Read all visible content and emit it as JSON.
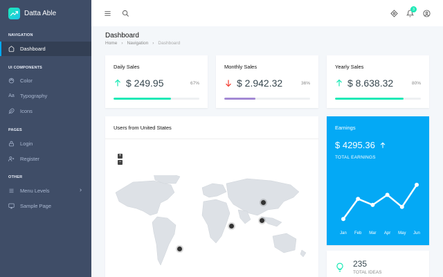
{
  "app": {
    "name": "Datta Able"
  },
  "sidebar": {
    "sections": [
      {
        "caption": "NAVIGATION",
        "items": [
          {
            "label": "Dashboard",
            "icon": "home-icon",
            "active": true
          }
        ]
      },
      {
        "caption": "UI COMPONENTS",
        "items": [
          {
            "label": "Color",
            "icon": "palette-icon"
          },
          {
            "label": "Typography",
            "icon": "typography-icon"
          },
          {
            "label": "Icons",
            "icon": "feather-icon"
          }
        ]
      },
      {
        "caption": "PAGES",
        "items": [
          {
            "label": "Login",
            "icon": "lock-icon"
          },
          {
            "label": "Register",
            "icon": "user-plus-icon"
          }
        ]
      },
      {
        "caption": "OTHER",
        "items": [
          {
            "label": "Menu Levels",
            "icon": "menu-icon"
          },
          {
            "label": "Sample Page",
            "icon": "monitor-icon"
          }
        ]
      }
    ]
  },
  "header": {
    "notification_count": "3"
  },
  "page": {
    "title": "Dashboard",
    "breadcrumb": [
      "Home",
      "Navigation",
      "Dashboard"
    ]
  },
  "sales": [
    {
      "title": "Daily Sales",
      "value": "$ 249.95",
      "percent": "67%",
      "progress": 0.67,
      "trend": "up",
      "color": "#1de9b6"
    },
    {
      "title": "Monthly Sales",
      "value": "$ 2.942.32",
      "percent": "36%",
      "progress": 0.36,
      "trend": "down",
      "color": "#a389d4"
    },
    {
      "title": "Yearly Sales",
      "value": "$ 8.638.32",
      "percent": "80%",
      "progress": 0.8,
      "trend": "up",
      "color": "#1de9b6"
    }
  ],
  "map": {
    "title": "Users from United States",
    "zoom_in": "+",
    "zoom_out": "−"
  },
  "earnings": {
    "title": "Earnings",
    "value": "$ 4295.36",
    "label": "TOTAL EARNINGS",
    "chart_data": {
      "type": "line",
      "categories": [
        "Jan",
        "Feb",
        "Mar",
        "Apr",
        "May",
        "Jun"
      ],
      "values": [
        10,
        60,
        45,
        70,
        40,
        95
      ],
      "ylim": [
        0,
        100
      ]
    }
  },
  "ideas": {
    "value": "235",
    "label": "TOTAL IDEAS"
  },
  "colors": {
    "sidebar": "#3f4d67",
    "accent": "#04a9f5",
    "green": "#1de9b6",
    "red": "#f44236",
    "purple": "#a389d4"
  }
}
